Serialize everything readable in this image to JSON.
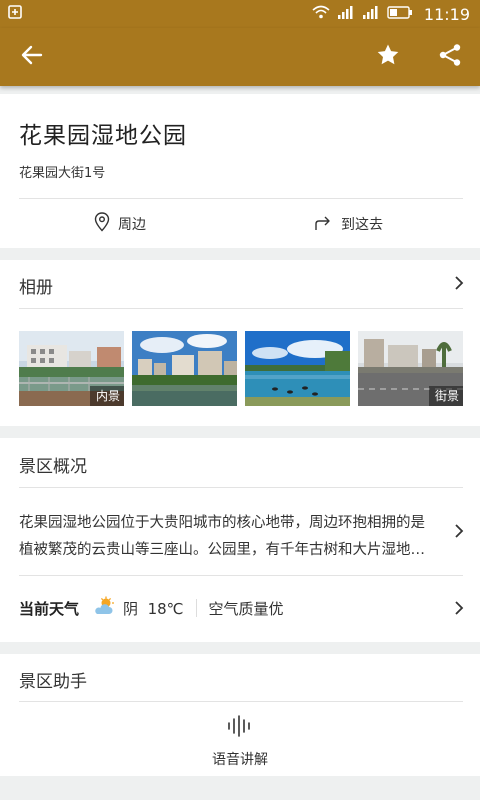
{
  "status_bar": {
    "time": "11:19"
  },
  "colors": {
    "brand": "#a8781e",
    "background": "#eef0f0",
    "sun": "#f5a623",
    "cloud": "#8fc4e8"
  },
  "app_bar": {
    "icons": [
      "back-arrow-icon",
      "star-icon",
      "share-icon"
    ]
  },
  "place": {
    "name": "花果园湿地公园",
    "address": "花果园大街1号",
    "actions": [
      {
        "label": "周边",
        "icon": "location-pin-icon"
      },
      {
        "label": "到这去",
        "icon": "route-arrow-icon"
      }
    ]
  },
  "album": {
    "title": "相册",
    "photos": [
      {
        "label": "内景",
        "scene": "buildings-by-water"
      },
      {
        "label": "",
        "scene": "apartments-over-pond"
      },
      {
        "label": "",
        "scene": "lake-with-ducks"
      },
      {
        "label": "街景",
        "scene": "street-road"
      }
    ]
  },
  "overview": {
    "title": "景区概况",
    "description": "花果园湿地公园位于大贵阳城市的核心地带，周边环抱相拥的是植被繁茂的云贵山等三座山。公园里，有千年古树和大片湿地植被，景色宜人。",
    "weather_label": "当前天气",
    "weather_condition": "阴",
    "temperature": "18℃",
    "air_quality": "空气质量优"
  },
  "assistant": {
    "title": "景区助手",
    "voice_label": "语音讲解"
  }
}
